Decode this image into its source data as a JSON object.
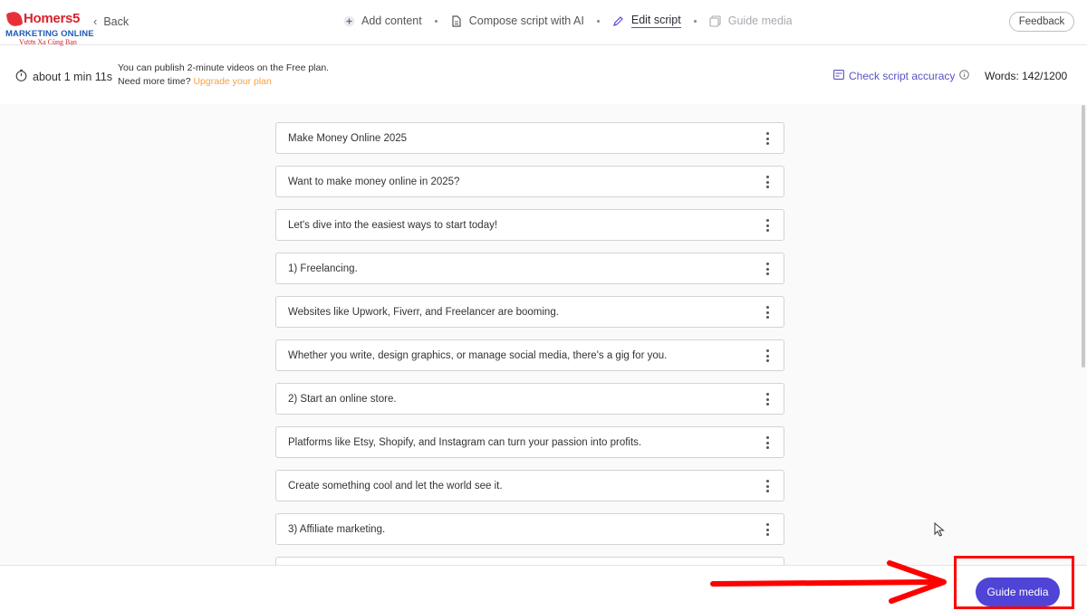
{
  "logo": {
    "brand": "Homers5",
    "line1": "MARKETING ONLINE",
    "line2": "Vươn Xa Cùng Bạn"
  },
  "header": {
    "back_label": "Back",
    "steps": [
      {
        "label": "Add content",
        "icon": "plus-icon",
        "state": "done"
      },
      {
        "label": "Compose script with AI",
        "icon": "document-icon",
        "state": "done"
      },
      {
        "label": "Edit script",
        "icon": "pencil-icon",
        "state": "active"
      },
      {
        "label": "Guide media",
        "icon": "media-icon",
        "state": "disabled"
      }
    ],
    "feedback_label": "Feedback"
  },
  "infobar": {
    "duration": "about 1 min 11s",
    "plan_line1": "You can publish 2-minute videos on the Free plan.",
    "plan_line2_prefix": "Need more time?",
    "upgrade_link": "Upgrade your plan",
    "accuracy_label": "Check script accuracy",
    "words_label": "Words: 142/1200"
  },
  "script_lines": [
    "Make Money Online 2025",
    "Want to make money online in 2025?",
    "Let's dive into the easiest ways to start today!",
    "1) Freelancing.",
    "Websites like Upwork, Fiverr, and Freelancer are booming.",
    "Whether you write, design graphics, or manage social media, there's a gig for you.",
    "2) Start an online store.",
    "Platforms like Etsy, Shopify, and Instagram can turn your passion into profits.",
    "Create something cool and let the world see it.",
    "3) Affiliate marketing.",
    ""
  ],
  "footer": {
    "primary_button": "Guide media"
  },
  "colors": {
    "accent": "#4f44d6",
    "upgrade": "#f5a142",
    "annotation": "#ff0000"
  }
}
